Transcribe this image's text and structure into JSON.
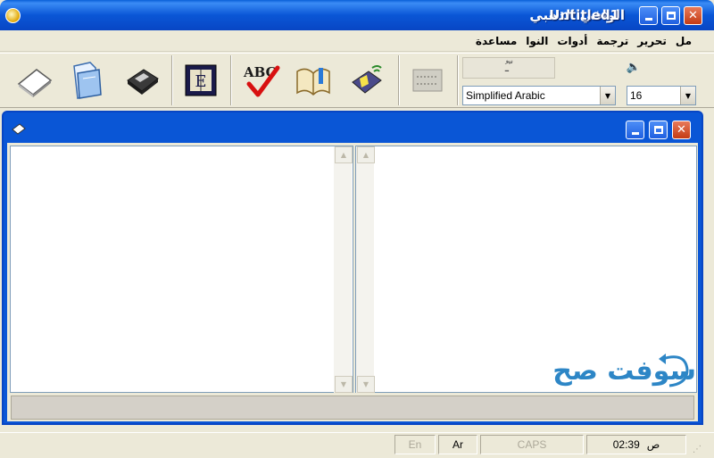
{
  "window": {
    "title": "الوافي الذهبي",
    "controls": {
      "minimize": "minimize",
      "maximize": "maximize",
      "close": "close"
    }
  },
  "menubar": {
    "items": [
      "مل",
      "تحرير",
      "ترجمة",
      "أدوات",
      "النوا",
      "مساعدة"
    ]
  },
  "toolbar": {
    "tools": [
      {
        "name": "new-document-icon"
      },
      {
        "name": "open-folder-icon"
      },
      {
        "name": "save-disk-icon"
      },
      {
        "name": "dictionary-icon"
      },
      {
        "name": "spell-check-icon",
        "label": "ABC"
      },
      {
        "name": "book-icon"
      },
      {
        "name": "speak-icon"
      },
      {
        "name": "disabled-tool-icon"
      }
    ],
    "font_name": "Simplified Arabic",
    "font_size": "16"
  },
  "document": {
    "title": "Untitled1",
    "left_pane_text": "",
    "right_pane_text": ""
  },
  "statusbar": {
    "time": "02:39",
    "time_suffix": "ص",
    "caps": "CAPS",
    "lang_ar": "Ar",
    "lang_en": "En"
  },
  "watermark": {
    "text": "سوفت صح"
  },
  "colors": {
    "title_blue": "#0a56d6",
    "close_red": "#c43b14",
    "watermark": "#2d86c6"
  }
}
